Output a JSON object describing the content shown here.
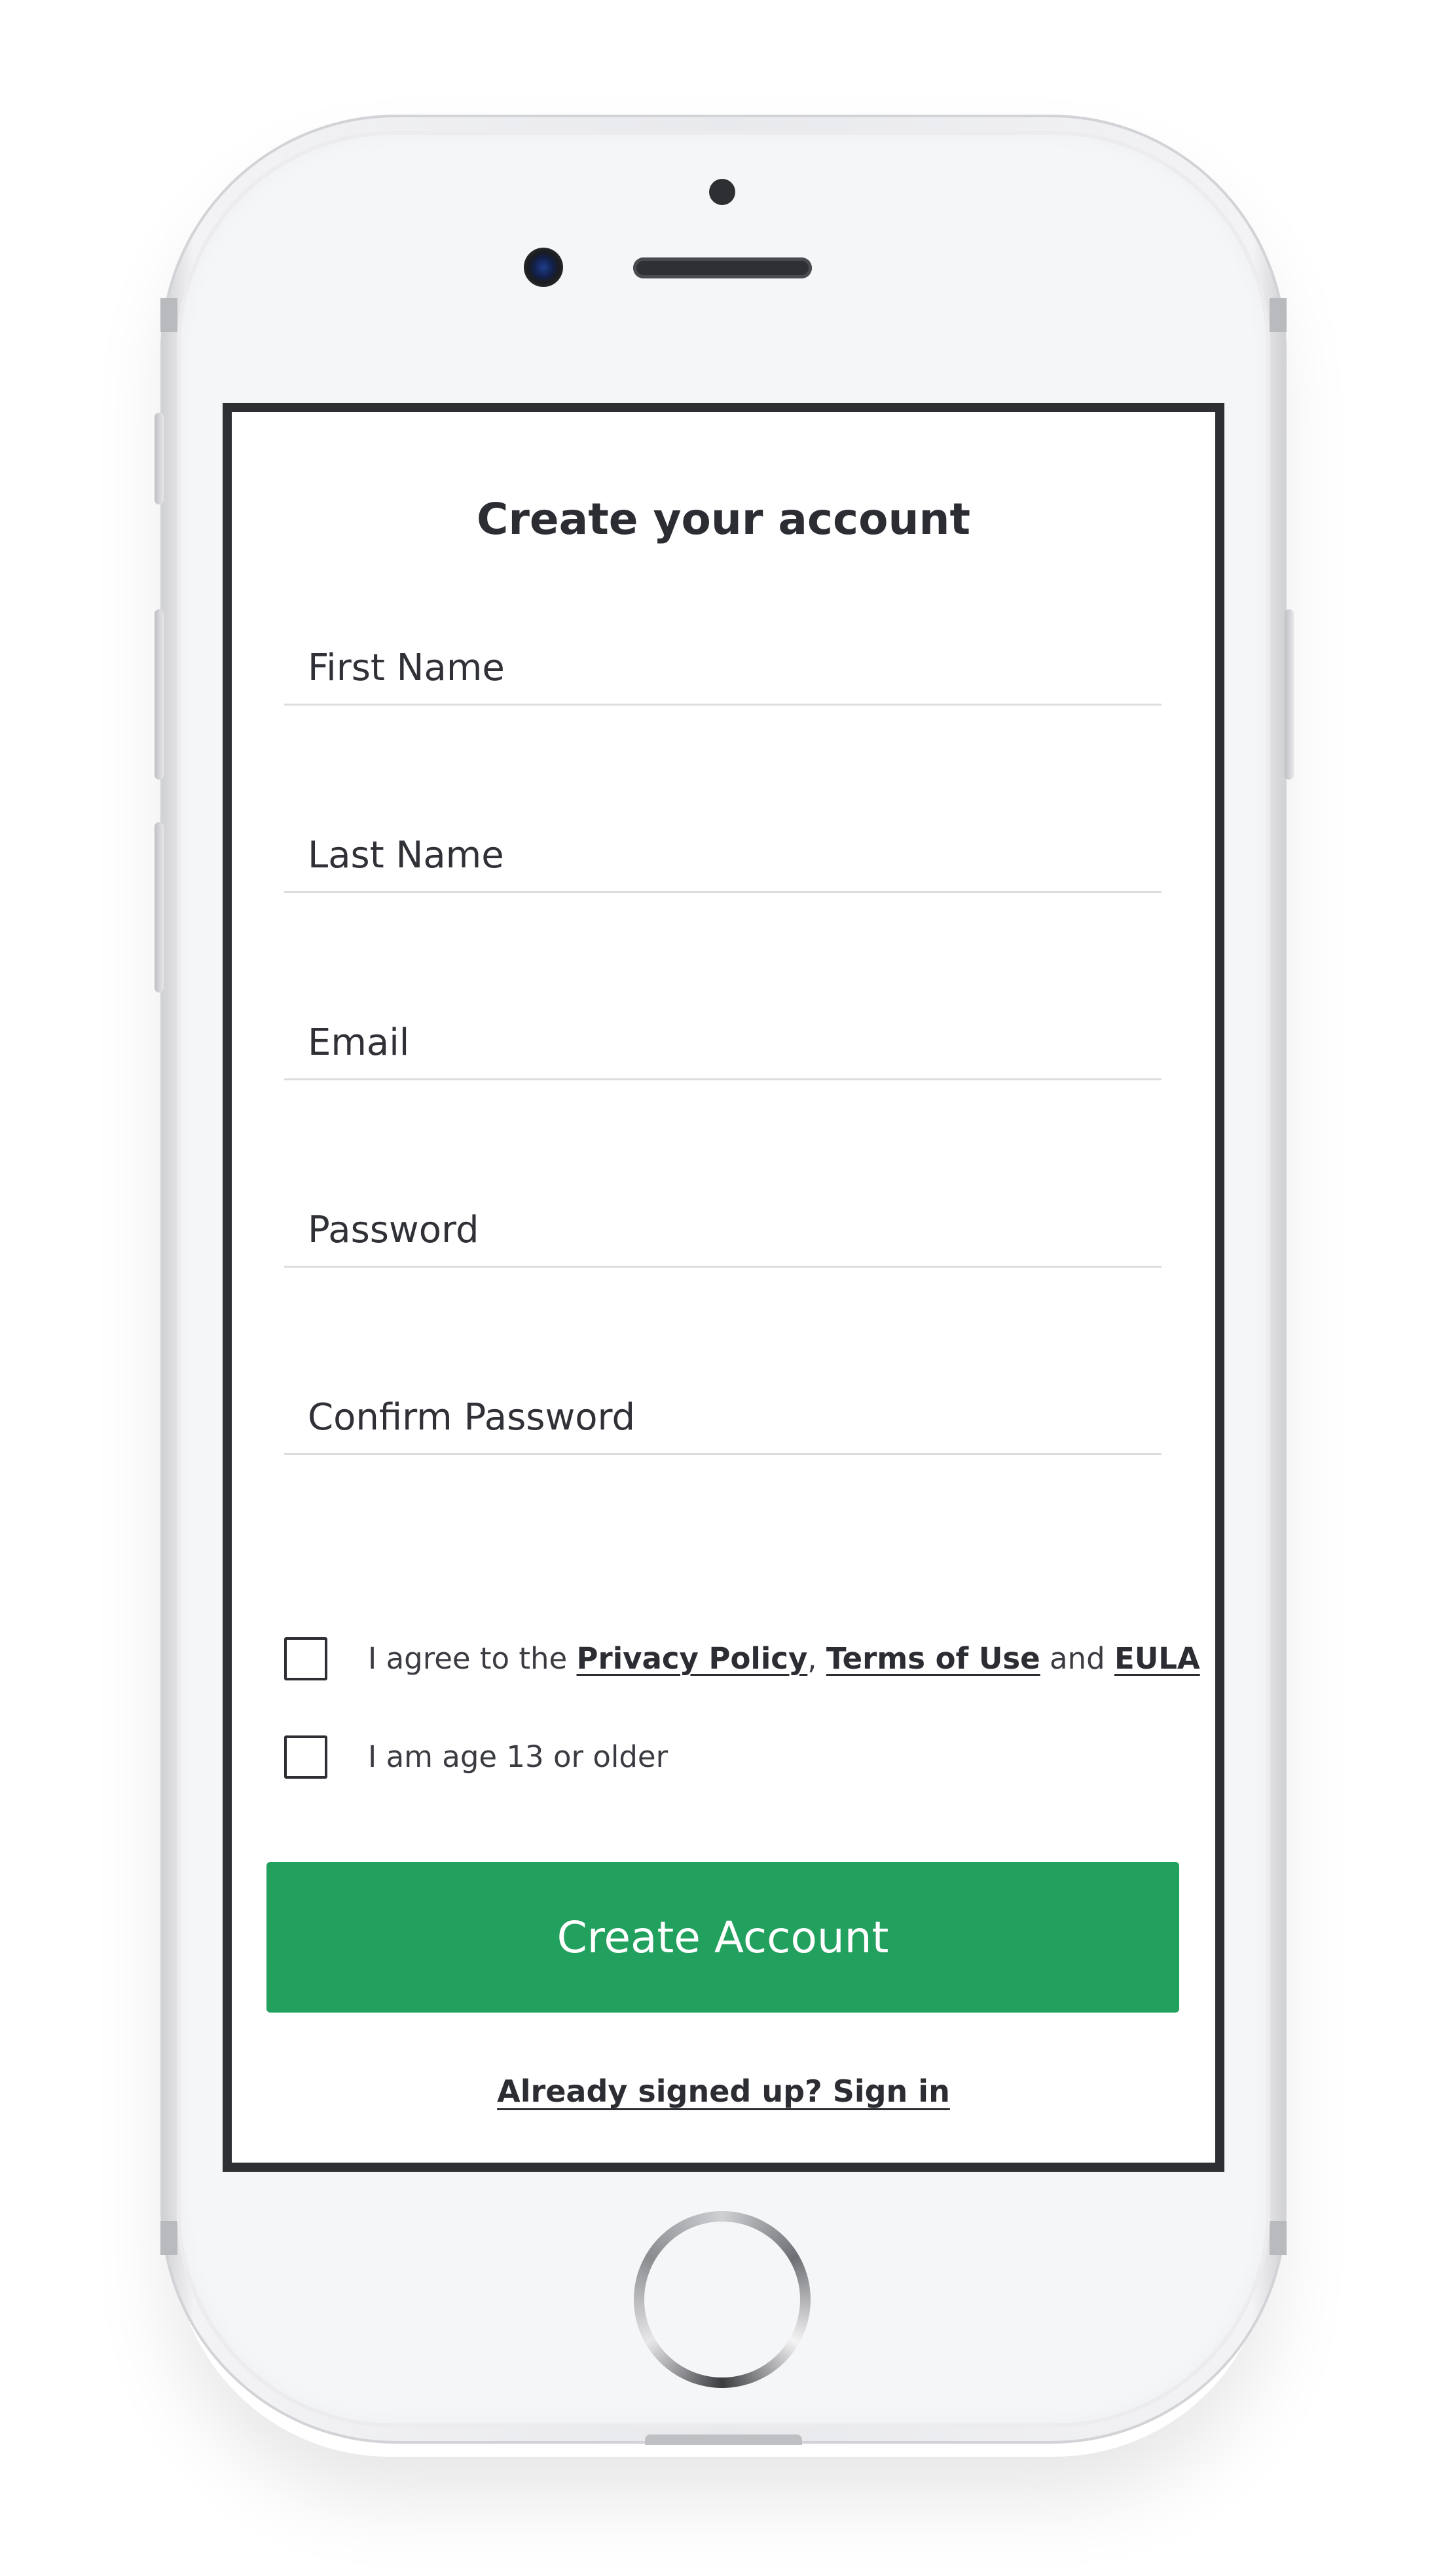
{
  "form": {
    "title": "Create your account",
    "fields": [
      {
        "placeholder": "First Name",
        "value": ""
      },
      {
        "placeholder": "Last Name",
        "value": ""
      },
      {
        "placeholder": "Email",
        "value": ""
      },
      {
        "placeholder": "Password",
        "value": ""
      },
      {
        "placeholder": "Confirm Password",
        "value": ""
      }
    ],
    "agree": {
      "prefix": "I agree to the ",
      "privacy_policy": "Privacy Policy",
      "separator": ", ",
      "terms_of_use": "Terms of Use",
      "and": " and ",
      "eula": "EULA",
      "checked": false
    },
    "age": {
      "label": "I am age 13 or older",
      "checked": false
    },
    "submit_label": "Create Account",
    "signin_label": "Already signed up? Sign in"
  },
  "colors": {
    "primary_button": "#22a05d",
    "text": "#2b2d33",
    "divider": "#dcdde0",
    "screen_border": "#2e2f33"
  },
  "icons": {
    "camera": "front-camera-icon",
    "home": "home-button-icon"
  }
}
